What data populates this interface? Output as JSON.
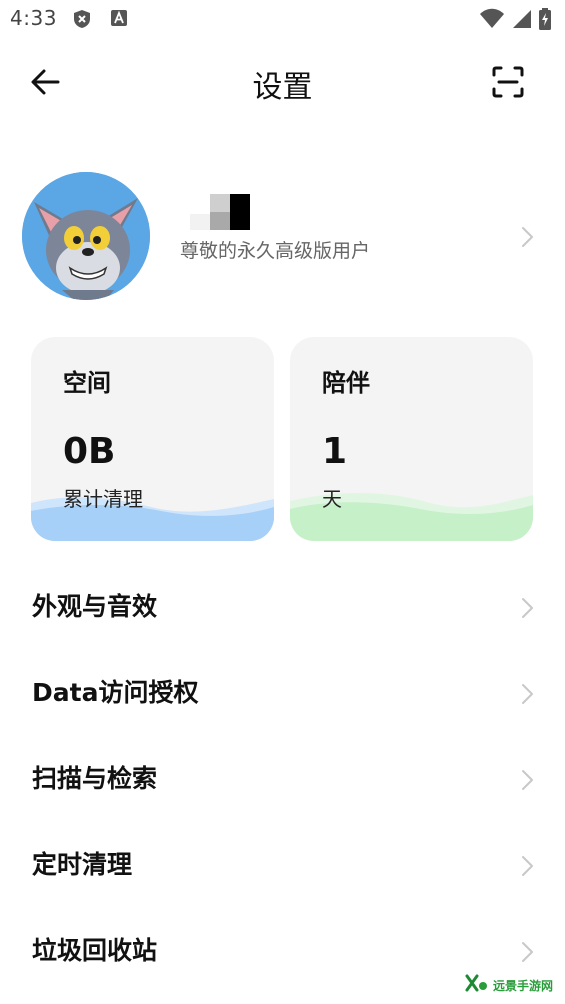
{
  "status_bar": {
    "time": "4:33",
    "icons": [
      "shield-icon",
      "a-box-icon",
      "wifi-icon",
      "signal-icon",
      "battery-icon"
    ]
  },
  "header": {
    "title": "设置",
    "back_icon": "arrow-left-icon",
    "scan_icon": "scan-icon"
  },
  "profile": {
    "subtitle": "尊敬的永久高级版用户",
    "avatar": "cartoon-cat-avatar"
  },
  "cards": [
    {
      "title": "空间",
      "value": "0B",
      "unit": "累计清理",
      "wave_color": "#a6d0f7"
    },
    {
      "title": "陪伴",
      "value": "1",
      "unit": "天",
      "wave_color": "#c6f0c8"
    }
  ],
  "menu": [
    {
      "label": "外观与音效"
    },
    {
      "label": "Data访问授权"
    },
    {
      "label": "扫描与检索"
    },
    {
      "label": "定时清理"
    },
    {
      "label": "垃圾回收站"
    }
  ],
  "watermark": {
    "text": "远景手游网"
  },
  "colors": {
    "space_wave": "#a6d0f7",
    "companion_wave": "#c6f0c8",
    "card_bg": "#f4f4f4",
    "chevron": "#c8c8c8"
  }
}
